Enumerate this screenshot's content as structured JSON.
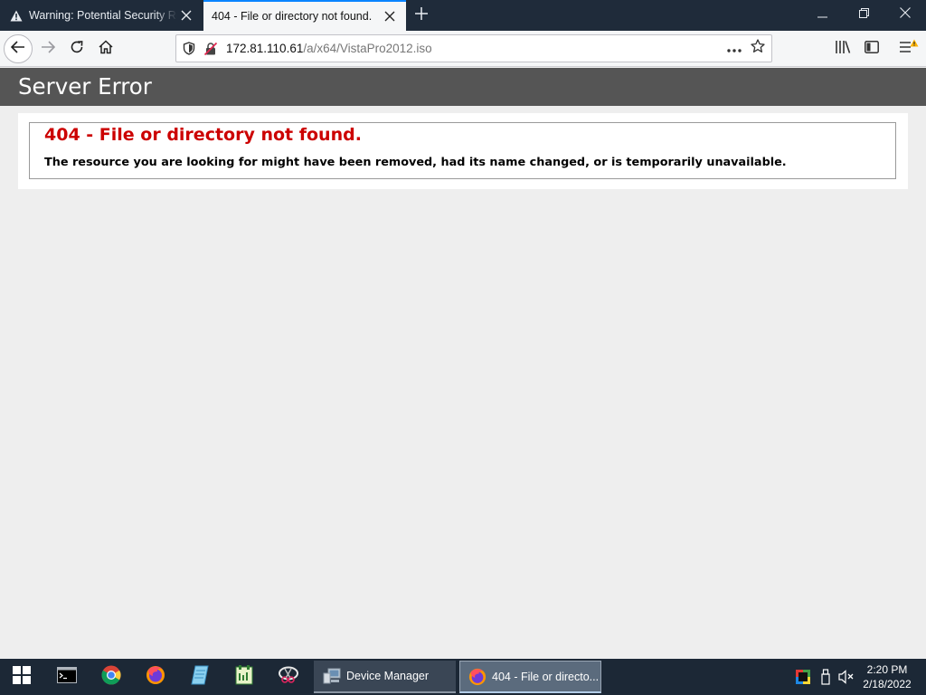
{
  "browser": {
    "tabs": [
      {
        "label": "Warning: Potential Security Risk",
        "icon": "warning-icon",
        "active": false
      },
      {
        "label": "404 - File or directory not found.",
        "icon": "none",
        "active": true
      }
    ],
    "url": {
      "host": "172.81.110.61",
      "path": "/a/x64/VistaPro2012.iso"
    },
    "accent_color": "#0a84ff"
  },
  "page": {
    "header_title": "Server Error",
    "error_title": "404 - File or directory not found.",
    "error_message": "The resource you are looking for might have been removed, had its name changed, or is temporarily unavailable.",
    "colors": {
      "header_bg": "#555555",
      "error_title": "#cc0000",
      "body_bg": "#eeeeee"
    }
  },
  "taskbar": {
    "pinned": [
      "start-icon",
      "cmd-icon",
      "chrome-icon",
      "firefox-icon",
      "notepad-icon",
      "sticky-icon",
      "snipping-icon"
    ],
    "apps": [
      {
        "label": "Device Manager",
        "icon": "device-manager-icon"
      },
      {
        "label": "404 - File or directo...",
        "icon": "firefox-icon",
        "active": true
      }
    ],
    "tray": [
      "color-icon",
      "usb-icon",
      "volume-muted-icon"
    ],
    "time": "2:20 PM",
    "date": "2/18/2022"
  }
}
